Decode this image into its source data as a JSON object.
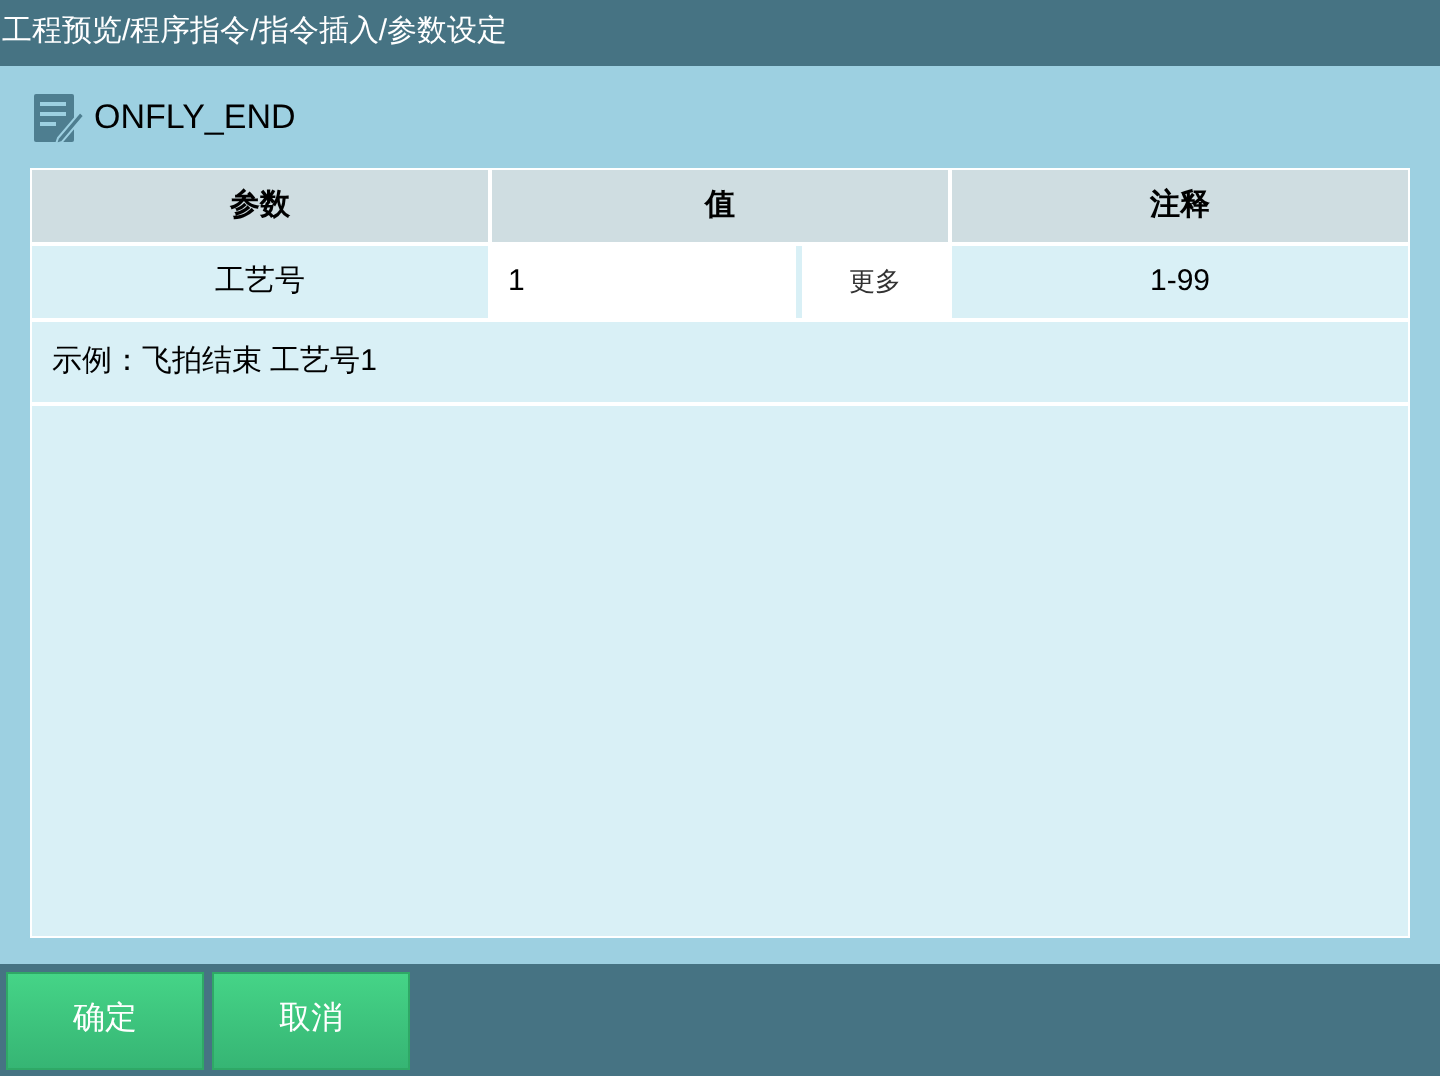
{
  "breadcrumb": "工程预览/程序指令/指令插入/参数设定",
  "instruction": {
    "name": "ONFLY_END"
  },
  "table": {
    "columns": [
      "参数",
      "值",
      "注释"
    ],
    "rows": [
      {
        "param": "工艺号",
        "value": "1",
        "more": "更多",
        "note": "1-99"
      }
    ],
    "example": "示例：飞拍结束 工艺号1"
  },
  "buttons": [
    "确定",
    "取消"
  ]
}
